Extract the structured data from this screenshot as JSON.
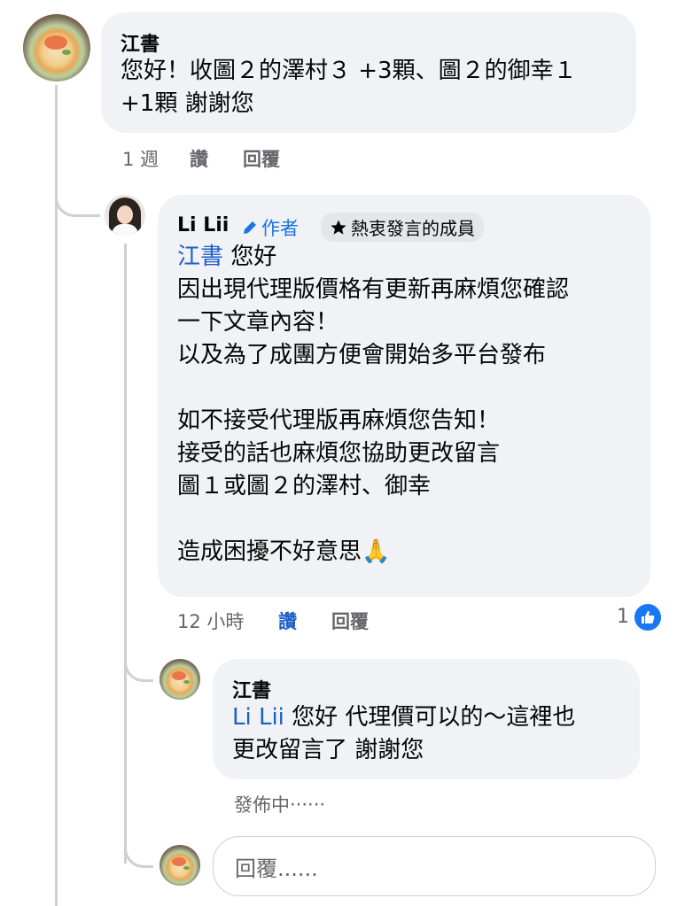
{
  "comment1": {
    "author": "江書",
    "text": "您好！收圖２的澤村３ +3顆、圖２的御幸１\n+1顆 謝謝您",
    "time": "1 週",
    "like_label": "讚",
    "reply_label": "回覆"
  },
  "reply1": {
    "author": "Li Lii",
    "author_badge": "作者",
    "fan_badge": "熱衷發言的成員",
    "mention": "江書",
    "text_after_mention": " 您好\n因出現代理版價格有更新再麻煩您確認\n一下文章內容！\n以及為了成團方便會開始多平台發布\n\n如不接受代理版再麻煩您告知！\n接受的話也麻煩您協助更改留言\n圖１或圖２的澤村、御幸\n\n造成困擾不好意思",
    "emoji": "🙏",
    "time": "12 小時",
    "like_label": "讚",
    "reply_label": "回覆",
    "reaction_count": "1",
    "reaction_icon": "like-thumb-icon",
    "accent_color": "#1877f2"
  },
  "reply2": {
    "author": "江書",
    "mention": "Li Lii",
    "text_after_mention": " 您好 代理價可以的～這裡也\n更改留言了 謝謝您",
    "status": "發佈中‧‧‧‧‧‧"
  },
  "reply_box": {
    "placeholder": "回覆......"
  }
}
